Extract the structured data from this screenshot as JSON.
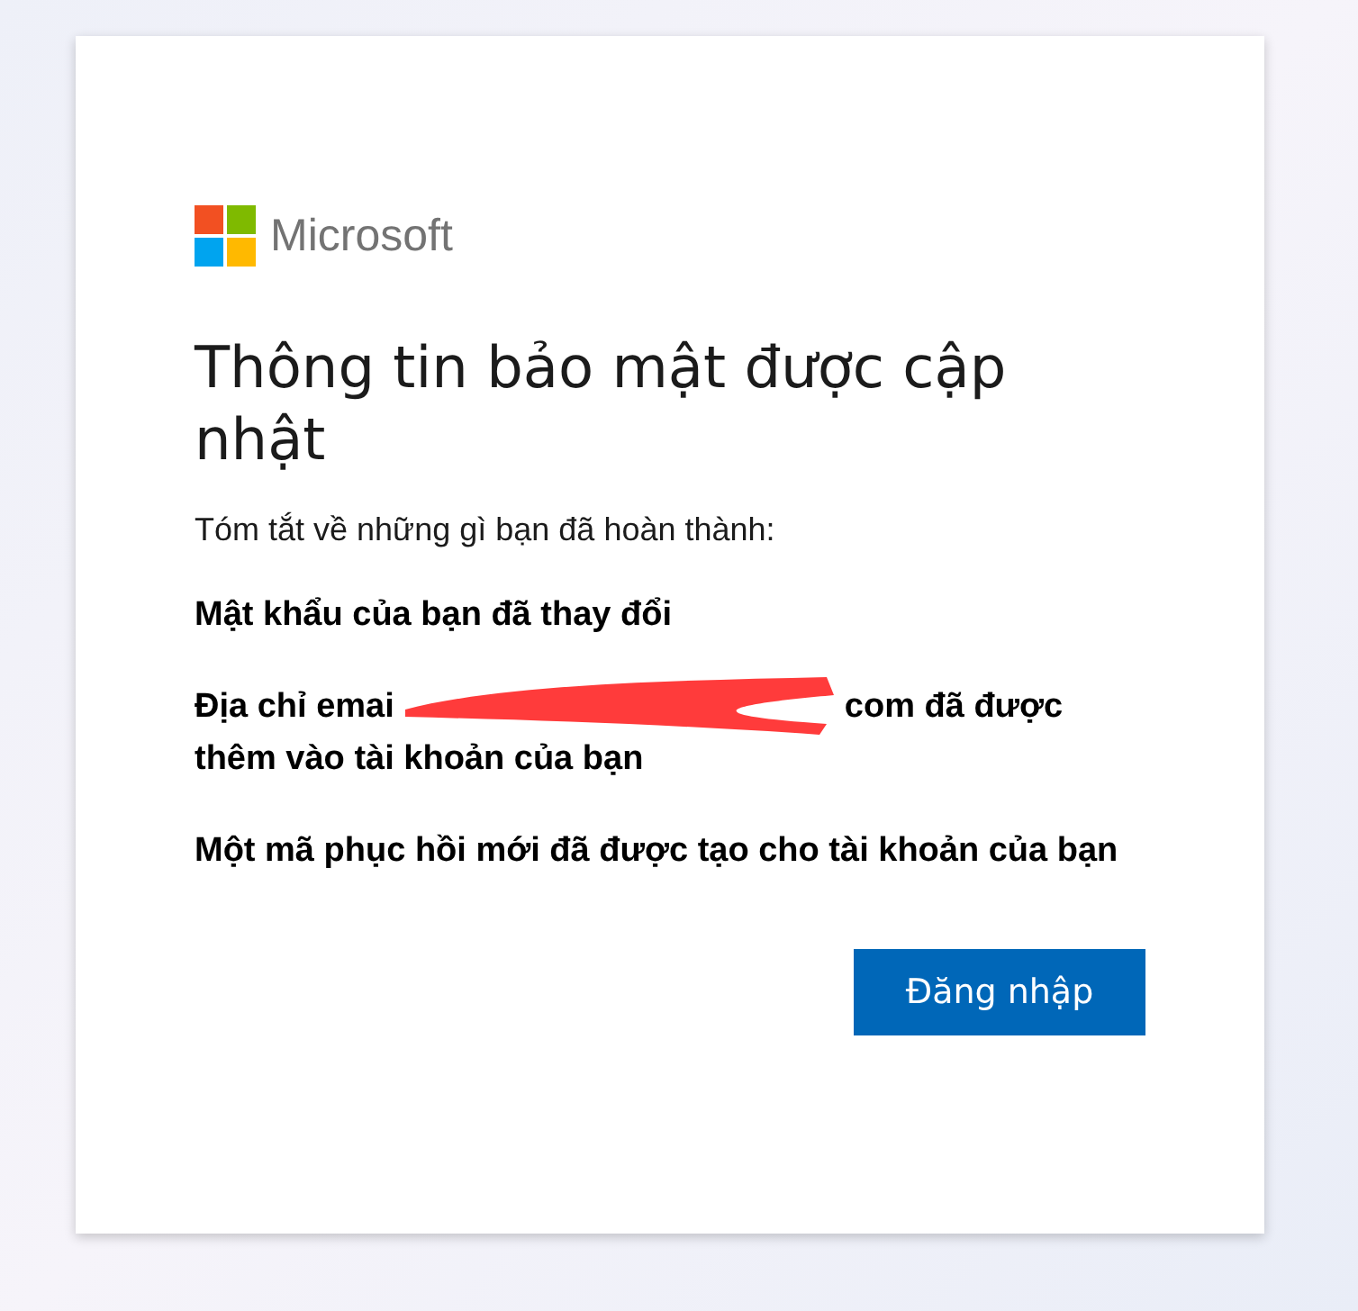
{
  "brand": {
    "name": "Microsoft"
  },
  "title": "Thông tin bảo mật được cập nhật",
  "intro": "Tóm tắt về những gì bạn đã hoàn thành:",
  "items": [
    {
      "kind": "plain",
      "text": "Mật khẩu của bạn đã thay đổi"
    },
    {
      "kind": "redacted",
      "before": "Địa chỉ emai",
      "after": "com đã được",
      "next_line": "thêm vào tài khoản của bạn"
    },
    {
      "kind": "plain",
      "text": "Một mã phục hồi mới đã được tạo cho tài khoản của bạn"
    }
  ],
  "button": "Đăng nhập"
}
